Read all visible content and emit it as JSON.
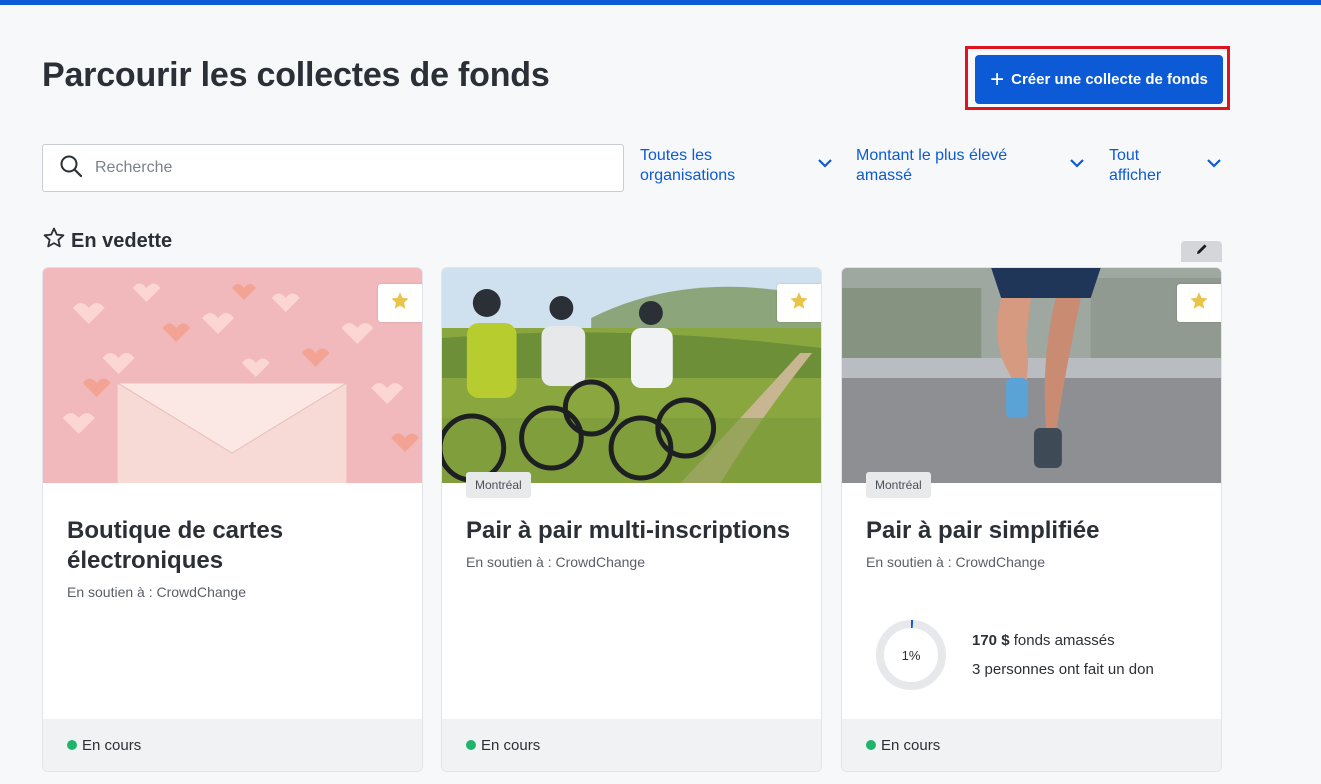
{
  "header": {
    "title": "Parcourir les collectes de fonds",
    "create_button": "Créer une collecte de fonds"
  },
  "search": {
    "placeholder": "Recherche",
    "value": ""
  },
  "filters": [
    {
      "label": "Toutes les organisations"
    },
    {
      "label": "Montant le plus élevé amassé"
    },
    {
      "label": "Tout afficher"
    }
  ],
  "featured": {
    "label": "En vedette"
  },
  "cards": [
    {
      "title": "Boutique de cartes électroniques",
      "support": "En soutien à : CrowdChange",
      "status": "En cours"
    },
    {
      "location": "Montréal",
      "title": "Pair à pair multi-inscriptions",
      "support": "En soutien à : CrowdChange",
      "status": "En cours"
    },
    {
      "location": "Montréal",
      "title": "Pair à pair simplifiée",
      "support": "En soutien à : CrowdChange",
      "progress_label": "1%",
      "progress_fraction": 0.01,
      "amount": "170 $",
      "amount_suffix": " fonds amassés",
      "donors": "3 personnes ont fait un don",
      "status": "En cours"
    }
  ],
  "icons": {
    "search": "search-icon",
    "chevron": "chevron-down-icon",
    "featured": "star-outline-icon",
    "favorite": "star-filled-icon",
    "edit": "pencil-icon",
    "add": "plus-icon"
  },
  "colors": {
    "accent": "#0c5ad6",
    "highlight_border": "#e0141e",
    "status_active": "#20b36b",
    "star": "#e9c44b"
  }
}
